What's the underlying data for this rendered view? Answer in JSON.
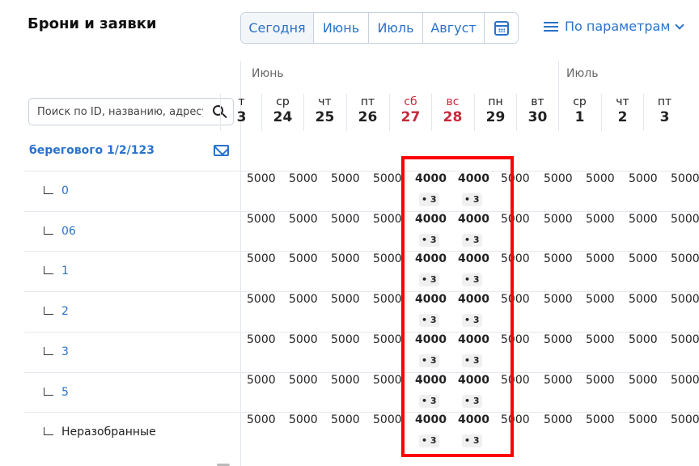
{
  "title": "Брони и заявки",
  "nav": {
    "today": "Сегодня",
    "months": [
      "Июнь",
      "Июль",
      "Август"
    ],
    "calendar_icon": "calendar-icon"
  },
  "filter": {
    "label": "По параметрам",
    "icon": "filter-lines-icon",
    "chevron": "chevron-down-icon"
  },
  "search": {
    "placeholder": "Поиск по ID, названию, адресу",
    "icon": "search-icon"
  },
  "property": {
    "name": "берегового 1/2/123",
    "icon": "mail-icon"
  },
  "rooms": [
    "0",
    "06",
    "1",
    "2",
    "3",
    "5",
    "Неразобранные"
  ],
  "months_header": [
    "Июнь",
    "Июль"
  ],
  "days": [
    {
      "dw": "т",
      "dn": "3",
      "weekend": false
    },
    {
      "dw": "ср",
      "dn": "24",
      "weekend": false
    },
    {
      "dw": "чт",
      "dn": "25",
      "weekend": false
    },
    {
      "dw": "пт",
      "dn": "26",
      "weekend": false
    },
    {
      "dw": "сб",
      "dn": "27",
      "weekend": true
    },
    {
      "dw": "вс",
      "dn": "28",
      "weekend": true
    },
    {
      "dw": "пн",
      "dn": "29",
      "weekend": false
    },
    {
      "dw": "вт",
      "dn": "30",
      "weekend": false
    },
    {
      "dw": "ср",
      "dn": "1",
      "weekend": false
    },
    {
      "dw": "чт",
      "dn": "2",
      "weekend": false
    },
    {
      "dw": "пт",
      "dn": "3",
      "weekend": false
    }
  ],
  "prices": {
    "regular": "5000",
    "weekend": "4000",
    "weekend_badge": "• 3"
  },
  "colors": {
    "accent": "#2a72c9",
    "weekend": "#c7283a",
    "highlight": "#ff0000"
  }
}
